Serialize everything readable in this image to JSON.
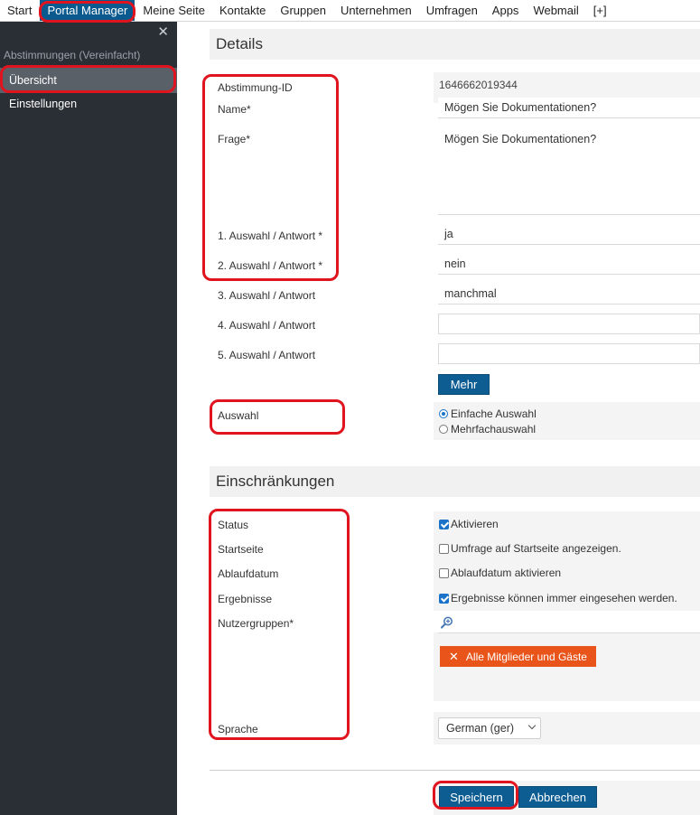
{
  "topnav": {
    "items": [
      "Start",
      "Portal Manager",
      "Meine Seite",
      "Kontakte",
      "Gruppen",
      "Unternehmen",
      "Umfragen",
      "Apps",
      "Webmail",
      "[+]"
    ],
    "active_index": 1
  },
  "sidebar": {
    "section_label": "Abstimmungen (Vereinfacht)",
    "items": [
      "Übersicht",
      "Einstellungen"
    ],
    "active_index": 0
  },
  "details": {
    "title": "Details",
    "id_label": "Abstimmung-ID",
    "id_value": "1646662019344",
    "name_label": "Name*",
    "name_value": "Mögen Sie Dokumentationen?",
    "question_label": "Frage*",
    "question_value": "Mögen Sie Dokumentationen?",
    "answers": [
      {
        "label": "1. Auswahl / Antwort *",
        "value": "ja"
      },
      {
        "label": "2. Auswahl / Antwort *",
        "value": "nein"
      },
      {
        "label": "3. Auswahl / Antwort",
        "value": "manchmal"
      },
      {
        "label": "4. Auswahl / Antwort",
        "value": ""
      },
      {
        "label": "5. Auswahl / Antwort",
        "value": ""
      }
    ],
    "more_label": "Mehr",
    "choice_label": "Auswahl",
    "choice_options": [
      "Einfache Auswahl",
      "Mehrfachauswahl"
    ],
    "choice_selected": 0
  },
  "restrictions": {
    "title": "Einschränkungen",
    "status_label": "Status",
    "status_text": "Aktivieren",
    "status_checked": true,
    "startpage_label": "Startseite",
    "startpage_text": "Umfrage auf Startseite angezeigen.",
    "startpage_checked": false,
    "expiry_label": "Ablaufdatum",
    "expiry_text": "Ablaufdatum aktivieren",
    "expiry_checked": false,
    "results_label": "Ergebnisse",
    "results_text": "Ergebnisse können immer eingesehen werden.",
    "results_checked": true,
    "groups_label": "Nutzergruppen*",
    "group_tag": "Alle Mitglieder und Gäste",
    "language_label": "Sprache",
    "language_value": "German (ger)"
  },
  "footer": {
    "save_label": "Speichern",
    "cancel_label": "Abbrechen"
  },
  "colors": {
    "accent_blue": "#0d5d93",
    "sidebar_bg": "#2a2f35",
    "tag_orange": "#e8541a",
    "highlight_red": "#e0141e"
  }
}
